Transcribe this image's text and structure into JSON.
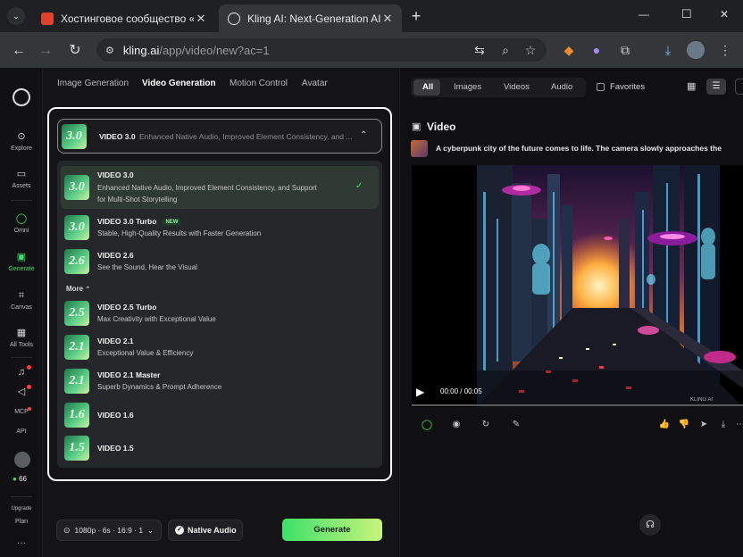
{
  "browser": {
    "tabs": [
      {
        "title": "Хостинговое сообщество «Tim",
        "active": false
      },
      {
        "title": "Kling AI: Next-Generation AI Cr",
        "active": true
      }
    ],
    "new_tab": "+",
    "url_host": "kling.ai",
    "url_path": "/app/video/new?ac=1",
    "window_controls": [
      "—",
      "☐",
      "✕"
    ]
  },
  "rail": {
    "items": [
      {
        "label": "Explore",
        "icon": "compass-icon"
      },
      {
        "label": "Assets",
        "icon": "folder-icon"
      },
      {
        "label": "Omni",
        "icon": "omni-ring-icon"
      },
      {
        "label": "Generate",
        "icon": "generate-icon"
      },
      {
        "label": "Canvas",
        "icon": "canvas-icon"
      },
      {
        "label": "All Tools",
        "icon": "grid-icon"
      },
      {
        "label": "MCP",
        "icon": "mcp-icon"
      },
      {
        "label": "API",
        "icon": "api-icon"
      }
    ],
    "credits": "66",
    "upgrade": "Upgrade",
    "plan": "Plan",
    "more": "···"
  },
  "mode_tabs": [
    "Image Generation",
    "Video Generation",
    "Motion Control",
    "Avatar"
  ],
  "selector": {
    "thumb": "3.0",
    "name": "VIDEO 3.0",
    "desc": "Enhanced Native Audio, Improved Element Consistency, and ..."
  },
  "menu": {
    "items": [
      {
        "thumb": "3.0",
        "name": "VIDEO 3.0",
        "desc": "Enhanced Native Audio, Improved Element Consistency, and Support",
        "desc2": "for Multi-Shot Storytelling",
        "selected": true
      },
      {
        "thumb": "3.0",
        "name": "VIDEO 3.0 Turbo",
        "badge": "NEW",
        "desc": "Stable, High-Quality Results with Faster Generation"
      },
      {
        "thumb": "2.6",
        "name": "VIDEO 2.6",
        "desc": "See the Sound, Hear the Visual"
      },
      {
        "thumb": "2.5",
        "name": "VIDEO 2.5 Turbo",
        "desc": "Max Creativity with Exceptional Value"
      },
      {
        "thumb": "2.1",
        "name": "VIDEO 2.1",
        "desc": "Exceptional Value & Efficiency"
      },
      {
        "thumb": "2.1",
        "name": "VIDEO 2.1 Master",
        "desc": "Superb Dynamics & Prompt Adherence"
      },
      {
        "thumb": "1.6",
        "name": "VIDEO 1.6",
        "desc": ""
      },
      {
        "thumb": "1.5",
        "name": "VIDEO 1.5",
        "desc": ""
      }
    ],
    "more_label": "More"
  },
  "bottom": {
    "settings": "1080p · 6s · 16:9 · 1",
    "native_audio": "Native Audio",
    "generate": "Generate"
  },
  "right": {
    "filters": [
      "All",
      "Images",
      "Videos",
      "Audio"
    ],
    "favorites": "Favorites",
    "section_title": "Video",
    "prompt": "A cyberpunk city of the future comes to life. The camera slowly approaches the",
    "time": "00:00 / 00:05",
    "watermark": "KLING AI"
  },
  "colors": {
    "accent_green": "#3de06a",
    "selected_item_bg": "#2f3a33",
    "frame_white": "#ffffff"
  }
}
